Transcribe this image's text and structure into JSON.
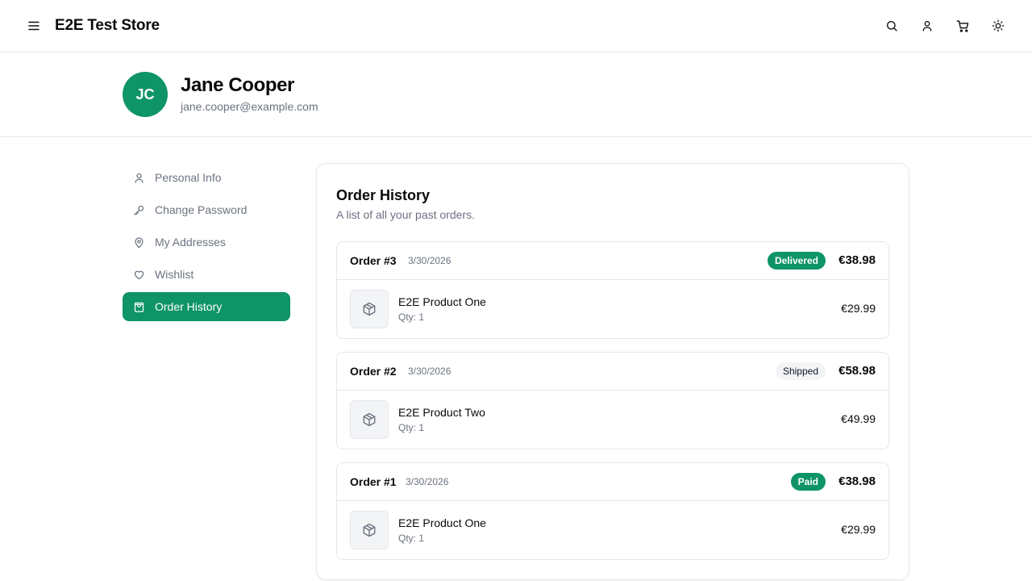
{
  "header": {
    "brand": "E2E Test Store",
    "icons": [
      "menu-icon",
      "search-icon",
      "user-icon",
      "cart-icon",
      "sun-icon"
    ]
  },
  "profile": {
    "initials": "JC",
    "name": "Jane Cooper",
    "email": "jane.cooper@example.com"
  },
  "sidebar": {
    "items": [
      {
        "label": "Personal Info",
        "icon": "user-icon",
        "active": false
      },
      {
        "label": "Change Password",
        "icon": "key-icon",
        "active": false
      },
      {
        "label": "My Addresses",
        "icon": "map-pin-icon",
        "active": false
      },
      {
        "label": "Wishlist",
        "icon": "heart-icon",
        "active": false
      },
      {
        "label": "Order History",
        "icon": "shopping-bag-icon",
        "active": true
      }
    ]
  },
  "orders_panel": {
    "title": "Order History",
    "subtitle": "A list of all your past orders.",
    "orders": [
      {
        "number": "Order #3",
        "date": "3/30/2026",
        "status": "Delivered",
        "total": "€38.98",
        "items": [
          {
            "name": "E2E Product One",
            "qty": "Qty: 1",
            "price": "€29.99",
            "icon": "package-icon"
          }
        ]
      },
      {
        "number": "Order #2",
        "date": "3/30/2026",
        "status": "Shipped",
        "total": "€58.98",
        "items": [
          {
            "name": "E2E Product Two",
            "qty": "Qty: 1",
            "price": "€49.99",
            "icon": "package-icon"
          }
        ]
      },
      {
        "number": "Order #1",
        "date": "3/30/2026",
        "status": "Paid",
        "total": "€38.98",
        "items": [
          {
            "name": "E2E Product One",
            "qty": "Qty: 1",
            "price": "€29.99",
            "icon": "package-icon"
          }
        ]
      }
    ]
  },
  "colors": {
    "accent": "#0e9467",
    "muted_text": "#6b7280",
    "border": "#e5e7eb",
    "badge_grey": "#f3f4f6"
  }
}
